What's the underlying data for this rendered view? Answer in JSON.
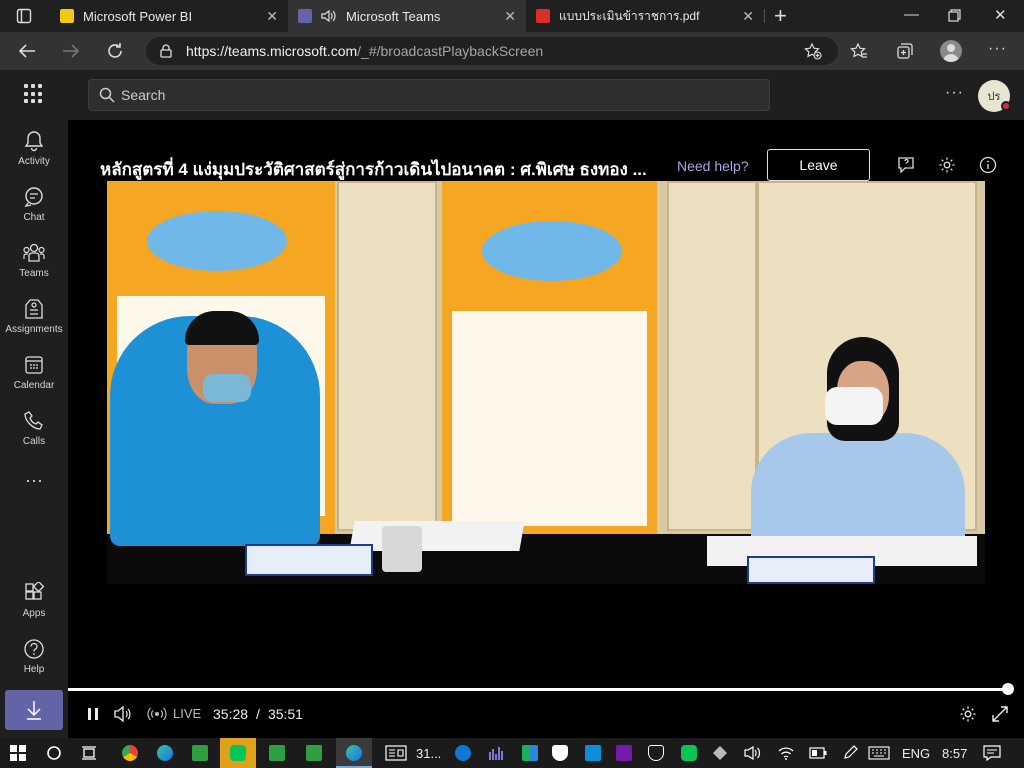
{
  "browser": {
    "tabs": [
      {
        "title": "Microsoft Power BI",
        "active": false,
        "favicon_color": "#f2c811",
        "icon": "power-bi-icon"
      },
      {
        "title": "Microsoft Teams",
        "active": true,
        "favicon_color": "#6264a7",
        "icon": "teams-icon"
      },
      {
        "title": "แบบประเมินข้าราชการ.pdf",
        "active": false,
        "favicon_color": "#d93025",
        "icon": "pdf-icon"
      }
    ],
    "url_host": "https://teams.microsoft.com",
    "url_path": "/_#/broadcastPlaybackScreen"
  },
  "teams": {
    "search_placeholder": "Search",
    "avatar_initials": "ปร",
    "rail": [
      {
        "label": "Activity",
        "icon": "bell-icon"
      },
      {
        "label": "Chat",
        "icon": "chat-icon"
      },
      {
        "label": "Teams",
        "icon": "teams-group-icon"
      },
      {
        "label": "Assignments",
        "icon": "assignments-icon"
      },
      {
        "label": "Calendar",
        "icon": "calendar-icon"
      },
      {
        "label": "Calls",
        "icon": "phone-icon"
      }
    ],
    "rail_bottom": [
      {
        "label": "Apps",
        "icon": "apps-icon"
      },
      {
        "label": "Help",
        "icon": "help-icon"
      }
    ],
    "accent": "#6264a7"
  },
  "broadcast": {
    "title": "หลักสูตรที่ 4 แง่มุมประวัติศาสตร์สู่การก้าวเดินไปอนาคต : ศ.พิเศษ ธงทอง ...",
    "help_link": "Need help?",
    "leave_label": "Leave",
    "live_label": "LIVE",
    "current_time": "35:28",
    "separator": "/",
    "total_time": "35:51",
    "progress": 0.99
  },
  "taskbar": {
    "task_label": "31...",
    "language": "ENG",
    "clock": "8:57"
  }
}
